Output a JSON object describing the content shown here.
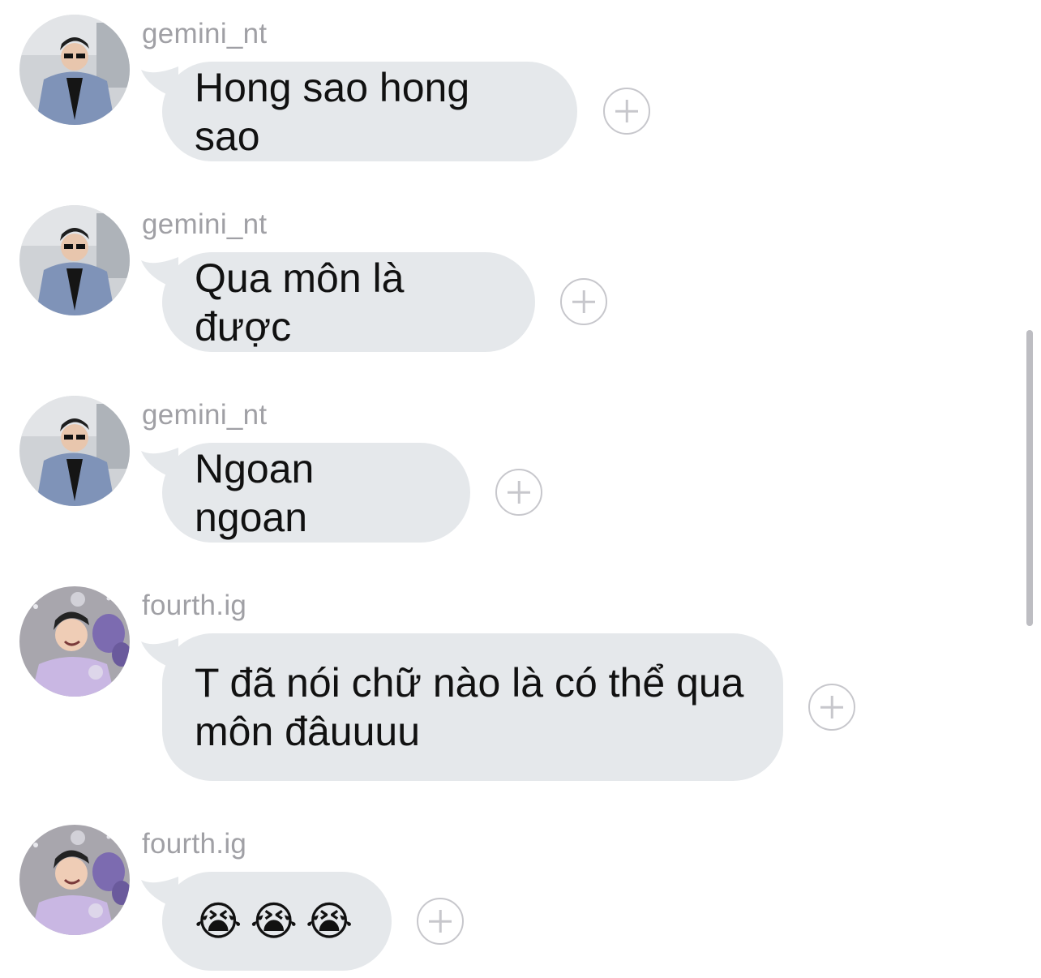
{
  "messages": [
    {
      "sender": "gemini_nt",
      "avatar_icon": "avatar-gemini-photo-icon",
      "text": "Hong sao hong sao",
      "reaction_button": "add-reaction-icon"
    },
    {
      "sender": "gemini_nt",
      "avatar_icon": "avatar-gemini-photo-icon",
      "text": "Qua môn là được",
      "reaction_button": "add-reaction-icon"
    },
    {
      "sender": "gemini_nt",
      "avatar_icon": "avatar-gemini-photo-icon",
      "text": "Ngoan ngoan",
      "reaction_button": "add-reaction-icon"
    },
    {
      "sender": "fourth.ig",
      "avatar_icon": "avatar-fourth-photo-icon",
      "text": "T đã nói chữ nào là có thể qua\nmôn đâuuuu",
      "reaction_button": "add-reaction-icon"
    },
    {
      "sender": "fourth.ig",
      "avatar_icon": "avatar-fourth-photo-icon",
      "emojis": [
        "😭",
        "😭",
        "😭"
      ],
      "reaction_button": "add-reaction-icon"
    }
  ],
  "colors": {
    "bubble": "#e5e8eb",
    "sender_text": "#a0a0a5",
    "message_text": "#111111",
    "reaction_ring": "#c7c7cc"
  }
}
